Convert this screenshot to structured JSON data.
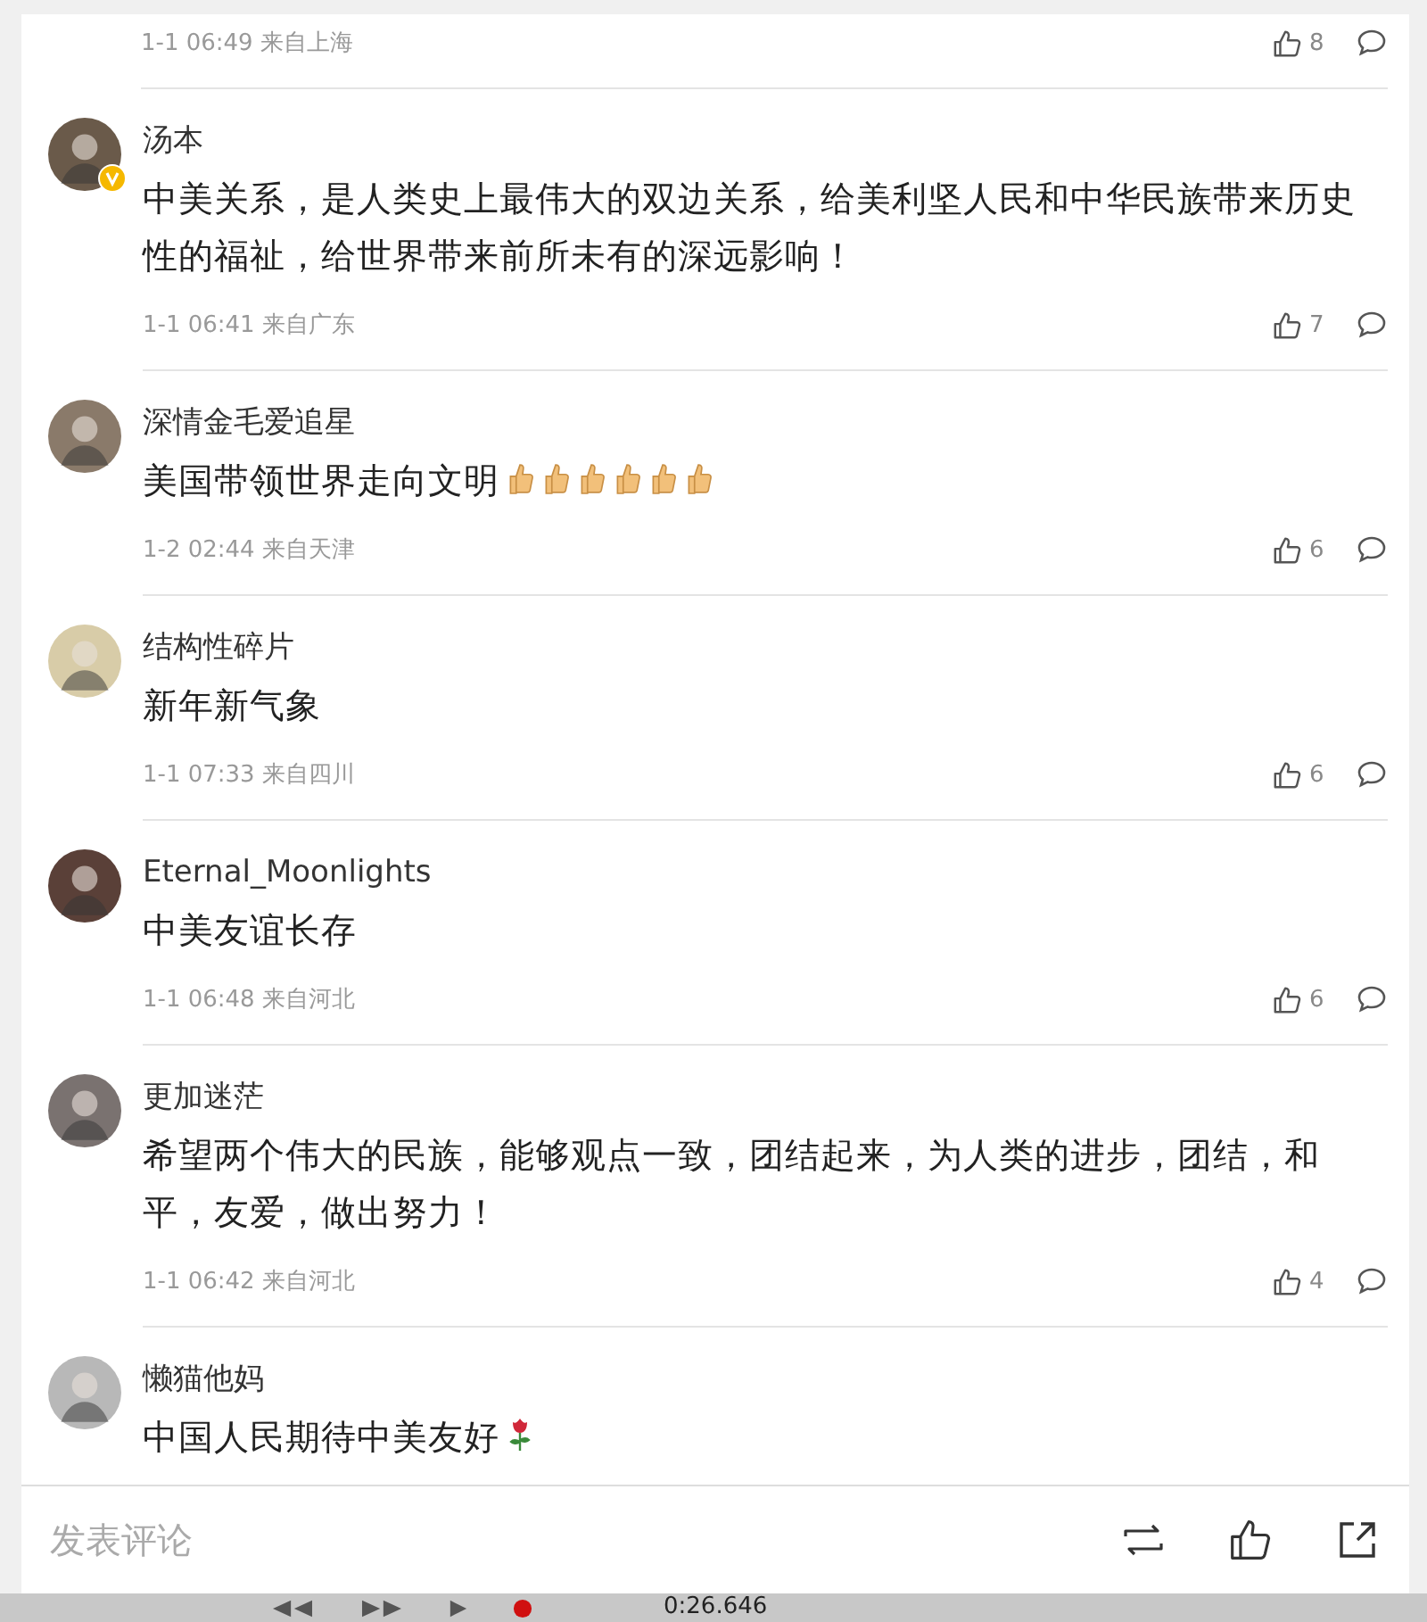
{
  "top_item": {
    "meta": "1-1 06:49 来自上海",
    "likes": "8"
  },
  "comments": [
    {
      "name": "汤本",
      "verified": true,
      "content": "中美关系，是人类史上最伟大的双边关系，给美利坚人民和中华民族带来历史性的福祉，给世界带来前所未有的深远影响！",
      "meta": "1-1 06:41 来自广东",
      "likes": "7"
    },
    {
      "name": "深情金毛爱追星",
      "verified": false,
      "content": "美国带领世界走向文明",
      "emojis": [
        {
          "kind": "thumbs-up"
        },
        {
          "kind": "thumbs-up"
        },
        {
          "kind": "thumbs-up"
        },
        {
          "kind": "thumbs-up"
        },
        {
          "kind": "thumbs-up"
        },
        {
          "kind": "thumbs-up"
        }
      ],
      "meta": "1-2 02:44 来自天津",
      "likes": "6"
    },
    {
      "name": "结构性碎片",
      "verified": false,
      "content": "新年新气象",
      "meta": "1-1 07:33 来自四川",
      "likes": "6"
    },
    {
      "name": "Eternal_Moonlights",
      "verified": false,
      "content": "中美友谊长存",
      "meta": "1-1 06:48 来自河北",
      "likes": "6"
    },
    {
      "name": "更加迷茫",
      "verified": false,
      "content": "希望两个伟大的民族，能够观点一致，团结起来，为人类的进步，团结，和平，友爱，做出努力！",
      "meta": "1-1 06:42 来自河北",
      "likes": "4"
    },
    {
      "name": "懒猫他妈",
      "verified": false,
      "content": "中国人民期待中美友好",
      "emojis": [
        {
          "kind": "rose"
        }
      ]
    }
  ],
  "comment_bar": {
    "placeholder": "发表评论"
  },
  "player": {
    "time": "0:26.646"
  }
}
